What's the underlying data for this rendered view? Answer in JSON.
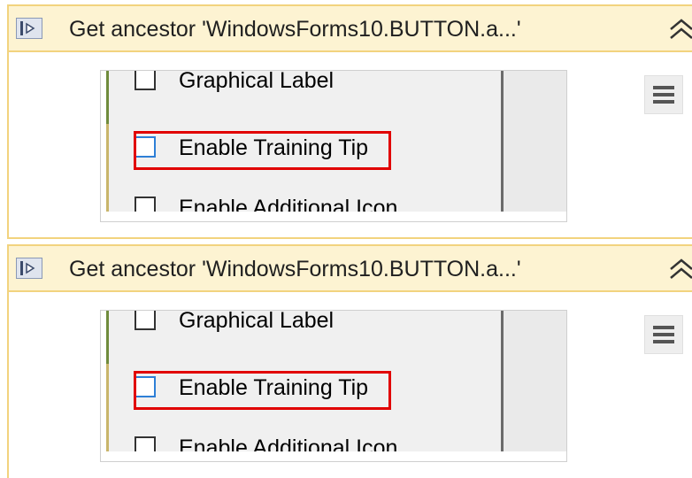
{
  "activities": [
    {
      "title": "Get ancestor 'WindowsForms10.BUTTON.a...'",
      "checkboxes": [
        {
          "label": "Graphical Label",
          "checked": false
        },
        {
          "label": "Enable Training Tip",
          "checked": false,
          "highlighted": true
        },
        {
          "label": "Enable Additional Icon",
          "checked": false
        }
      ]
    },
    {
      "title": "Get ancestor 'WindowsForms10.BUTTON.a...'",
      "checkboxes": [
        {
          "label": "Graphical Label",
          "checked": false
        },
        {
          "label": "Enable Training Tip",
          "checked": false,
          "highlighted": true
        },
        {
          "label": "Enable Additional Icon",
          "checked": false
        }
      ]
    }
  ],
  "colors": {
    "header_bg": "#fdf3d2",
    "header_border": "#f2d37e",
    "highlight_red": "#e10000",
    "checkbox_blue": "#2e7fd6"
  },
  "icons": [
    "activity-icon",
    "collapse-chevron-icon",
    "hamburger-menu-icon"
  ]
}
